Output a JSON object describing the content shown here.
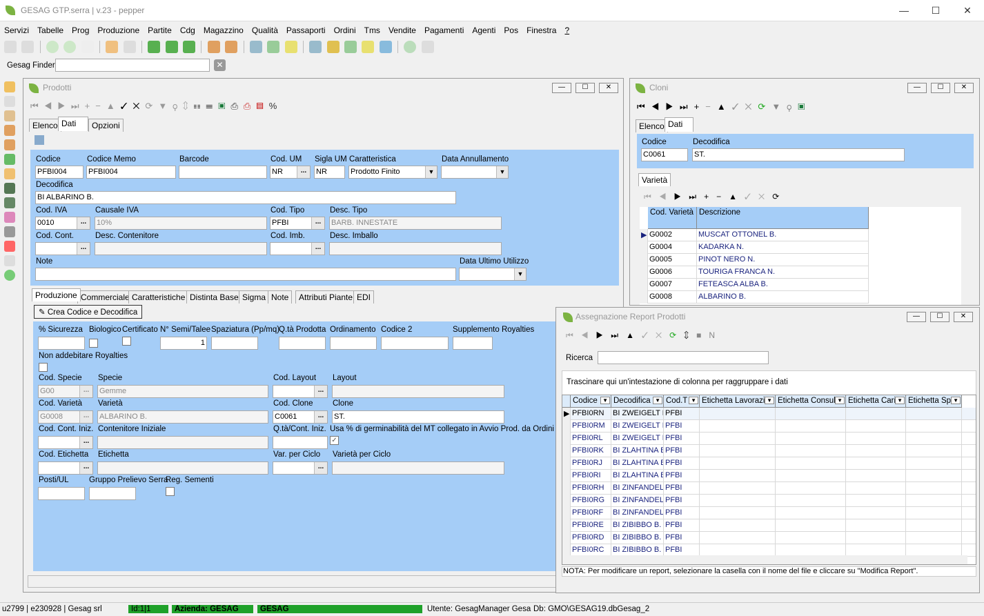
{
  "app": {
    "title": "GESAG GTP.serra | v.23 - pepper",
    "brand_color": "#7cb342",
    "min": "—",
    "max": "☐",
    "close": "✕"
  },
  "menu": [
    "Servizi",
    "Tabelle",
    "Prog",
    "Produzione",
    "Partite",
    "Cdg",
    "Magazzino",
    "Qualità",
    "Passaporti",
    "Ordini",
    "Tms",
    "Vendite",
    "Pagamenti",
    "Agenti",
    "Pos",
    "Finestra",
    "?"
  ],
  "finder": {
    "label": "Gesag Finder",
    "value": ""
  },
  "prodotti": {
    "title": "Prodotti",
    "tabs": [
      "Elenco",
      "Dati",
      "Opzioni"
    ],
    "labels": {
      "codice": "Codice",
      "codice_memo": "Codice Memo",
      "barcode": "Barcode",
      "cod_um": "Cod. UM",
      "sigla_um": "Sigla UM",
      "caratteristica": "Caratteristica",
      "data_annullamento": "Data Annullamento",
      "decodifica": "Decodifica",
      "cod_iva": "Cod. IVA",
      "causale_iva": "Causale IVA",
      "cod_tipo": "Cod. Tipo",
      "desc_tipo": "Desc. Tipo",
      "cod_cont": "Cod. Cont.",
      "desc_contenitore": "Desc. Contenitore",
      "cod_imb": "Cod. Imb.",
      "desc_imballo": "Desc. Imballo",
      "note": "Note",
      "data_ultimo_utilizzo": "Data Ultimo Utilizzo"
    },
    "values": {
      "codice": "PFBI004",
      "codice_memo": "PFBI004",
      "barcode": "",
      "cod_um": "NR",
      "sigla_um": "NR",
      "caratteristica": "Prodotto Finito",
      "decodifica": "BI ALBARINO B.",
      "cod_iva": "0010",
      "causale_iva": "10%",
      "cod_tipo": "PFBI",
      "desc_tipo": "BARB. INNESTATE"
    },
    "subtabs": [
      "Produzione",
      "Commerciale",
      "Caratteristiche",
      "Distinta Base",
      "Sigma",
      "Note",
      "Attributi Piante",
      "EDI"
    ],
    "crea_button": "Crea Codice e Decodifica",
    "prod_labels": {
      "sicurezza": "% Sicurezza",
      "biologico": "Biologico",
      "certificato": "Certificato",
      "semi": "N° Semi/Talee",
      "spaziatura": "Spaziatura (Pp/mq)",
      "qta_prodotta": "Q.tà Prodotta",
      "ordinamento": "Ordinamento",
      "codice2": "Codice 2",
      "supplemento": "Supplemento Royalties",
      "non_addebitare": "Non addebitare Royalties",
      "cod_specie": "Cod. Specie",
      "specie": "Specie",
      "cod_layout": "Cod. Layout",
      "layout": "Layout",
      "cod_varieta": "Cod. Varietà",
      "varieta": "Varietà",
      "cod_clone": "Cod. Clone",
      "clone": "Clone",
      "cod_cont_iniz": "Cod. Cont. Iniz.",
      "contenitore_iniziale": "Contenitore Iniziale",
      "qta_cont_iniz": "Q.tà/Cont. Iniz.",
      "usa_germ": "Usa % di germinabilità del MT collegato in Avvio Prod. da Ordini",
      "cod_etichetta": "Cod. Etichetta",
      "etichetta": "Etichetta",
      "var_ciclo": "Var. per Ciclo",
      "varieta_ciclo": "Varietà per Ciclo",
      "posti": "Posti/UL",
      "gruppo": "Gruppo Prelievo Serra",
      "reg_sementi": "Reg. Sementi"
    },
    "prod_values": {
      "semi": "1",
      "cod_specie": "G00",
      "specie": "Gemme",
      "cod_varieta": "G0008",
      "varieta": "ALBARINO B.",
      "cod_clone": "C0061",
      "clone": "ST.",
      "usa_germ_check": "✓"
    }
  },
  "cloni": {
    "title": "Cloni",
    "tabs": [
      "Elenco",
      "Dati"
    ],
    "labels": {
      "codice": "Codice",
      "decodifica": "Decodifica"
    },
    "values": {
      "codice": "C0061",
      "decodifica": "ST."
    },
    "subtab": "Varietà",
    "grid_headers": [
      "Cod. Varietà",
      "Descrizione"
    ],
    "rows": [
      [
        "G0002",
        "MUSCAT OTTONEL B."
      ],
      [
        "G0004",
        "KADARKA N."
      ],
      [
        "G0005",
        "PINOT NERO N."
      ],
      [
        "G0006",
        "TOURIGA FRANCA N."
      ],
      [
        "G0007",
        "FETEASCA ALBA B."
      ],
      [
        "G0008",
        "ALBARINO B."
      ]
    ]
  },
  "report": {
    "title": "Assegnazione Report Prodotti",
    "ricerca_label": "Ricerca",
    "group_hint": "Trascinare qui un'intestazione di colonna per raggruppare i dati",
    "headers": [
      "Codice",
      "Decodifica",
      "Cod.T",
      "Etichetta Lavorazio",
      "Etichetta Consul",
      "Etichetta Cari",
      "Etichetta Spe"
    ],
    "rows": [
      [
        "PFBI0RN",
        "BI ZWEIGELT N",
        "PFBI"
      ],
      [
        "PFBI0RM",
        "BI ZWEIGELT N",
        "PFBI"
      ],
      [
        "PFBI0RL",
        "BI ZWEIGELT N",
        "PFBI"
      ],
      [
        "PFBI0RK",
        "BI ZLAHTINA B",
        "PFBI"
      ],
      [
        "PFBI0RJ",
        "BI ZLAHTINA B",
        "PFBI"
      ],
      [
        "PFBI0RI",
        "BI ZLAHTINA B",
        "PFBI"
      ],
      [
        "PFBI0RH",
        "BI ZINFANDEL",
        "PFBI"
      ],
      [
        "PFBI0RG",
        "BI ZINFANDEL",
        "PFBI"
      ],
      [
        "PFBI0RF",
        "BI ZINFANDEL",
        "PFBI"
      ],
      [
        "PFBI0RE",
        "BI ZIBIBBO B. /",
        "PFBI"
      ],
      [
        "PFBI0RD",
        "BI ZIBIBBO B. /",
        "PFBI"
      ],
      [
        "PFBI0RC",
        "BI ZIBIBBO B. /",
        "PFBI"
      ]
    ],
    "note": "NOTA: Per modificare un report, selezionare la casella con il nome del file e cliccare su \"Modifica Report\"."
  },
  "status": {
    "user": "u2799 | e230928 | Gesag srl",
    "id": "Id:1|1",
    "azienda": "Azienda: GESAG",
    "gesag": "GESAG",
    "utente": "Utente: GesagManager Gesa",
    "db": "Db: GMO\\GESAG19.dbGesag_2"
  }
}
